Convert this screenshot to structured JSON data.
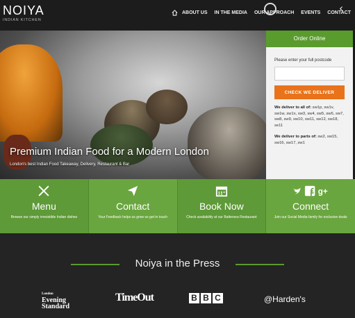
{
  "header": {
    "logo_text": "NOIYA",
    "logo_subtitle": "INDIAN KITCHEN",
    "nav": [
      "ABOUT US",
      "IN THE MEDIA",
      "OUR APPROACH",
      "EVENTS",
      "CONTACT"
    ]
  },
  "hero": {
    "title": "Premium Indian Food for a Modern London",
    "subtitle": "London's best Indian Food Takeaway, Delivery, Restaurant & Bar"
  },
  "order": {
    "heading": "Order Online",
    "label": "Please enter your full postcode",
    "input_value": "",
    "button": "CHECK WE DELIVER",
    "deliver_all_label": "We deliver to all of:",
    "deliver_all_areas": "sw1p, sw1v, sw1w, sw1x, sw3, sw4, sw5, sw6, sw7, sw8, sw9, sw10, sw11, sw12, sw18, se11",
    "deliver_parts_label": "We deliver to parts of:",
    "deliver_parts_areas": "sw2, sw15, sw16, sw17, sw1"
  },
  "tiles": [
    {
      "title": "Menu",
      "desc": "Browse our simply irresistible Indian dishes",
      "icon": "utensils-icon"
    },
    {
      "title": "Contact",
      "desc": "Your Feedback helps us grow so get in touch",
      "icon": "paper-plane-icon"
    },
    {
      "title": "Book Now",
      "desc": "Check availability at our Battersea Restaurant",
      "icon": "calendar-icon"
    },
    {
      "title": "Connect",
      "desc": "Join our Social Media family for exclusive deals",
      "icon": "social-icons"
    }
  ],
  "press": {
    "title": "Noiya in the Press",
    "logos": {
      "evening_standard_small": "London",
      "evening_standard": "Evening Standard",
      "time_out": "TimeOut",
      "bbc": [
        "B",
        "B",
        "C"
      ],
      "hardens": "@Harden's"
    }
  },
  "colors": {
    "green": "#5a9b2e",
    "orange": "#e8731a",
    "dark": "#1c1c1c"
  }
}
